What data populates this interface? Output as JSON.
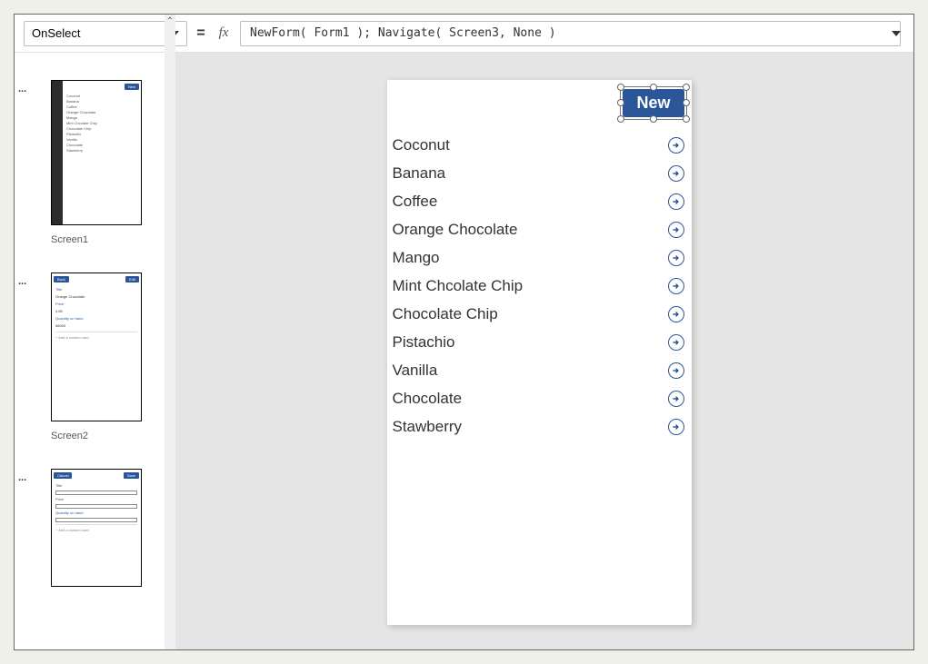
{
  "formula_bar": {
    "property": "OnSelect",
    "expression": "NewForm( Form1 ); Navigate( Screen3, None )"
  },
  "thumbnails": {
    "s1": {
      "label": "Screen1"
    },
    "s2": {
      "label": "Screen2"
    },
    "back_label": "Back",
    "edit_label": "Edit",
    "cancel_label": "Cancel",
    "save_label": "Save",
    "new_label": "New"
  },
  "preview": {
    "new_button": "New"
  },
  "gallery_items": [
    {
      "title": "Coconut"
    },
    {
      "title": "Banana"
    },
    {
      "title": "Coffee"
    },
    {
      "title": "Orange Chocolate"
    },
    {
      "title": "Mango"
    },
    {
      "title": "Mint Chcolate Chip"
    },
    {
      "title": "Chocolate Chip"
    },
    {
      "title": "Pistachio"
    },
    {
      "title": "Vanilla"
    },
    {
      "title": "Chocolate"
    },
    {
      "title": "Stawberry"
    }
  ],
  "mini_detail": {
    "f1": "Title",
    "v1": "Orange Chocolate",
    "f2": "Price",
    "v2": "3.89",
    "f3": "Quantity on hand",
    "v3": "58000",
    "add": "+  Add a custom card"
  }
}
